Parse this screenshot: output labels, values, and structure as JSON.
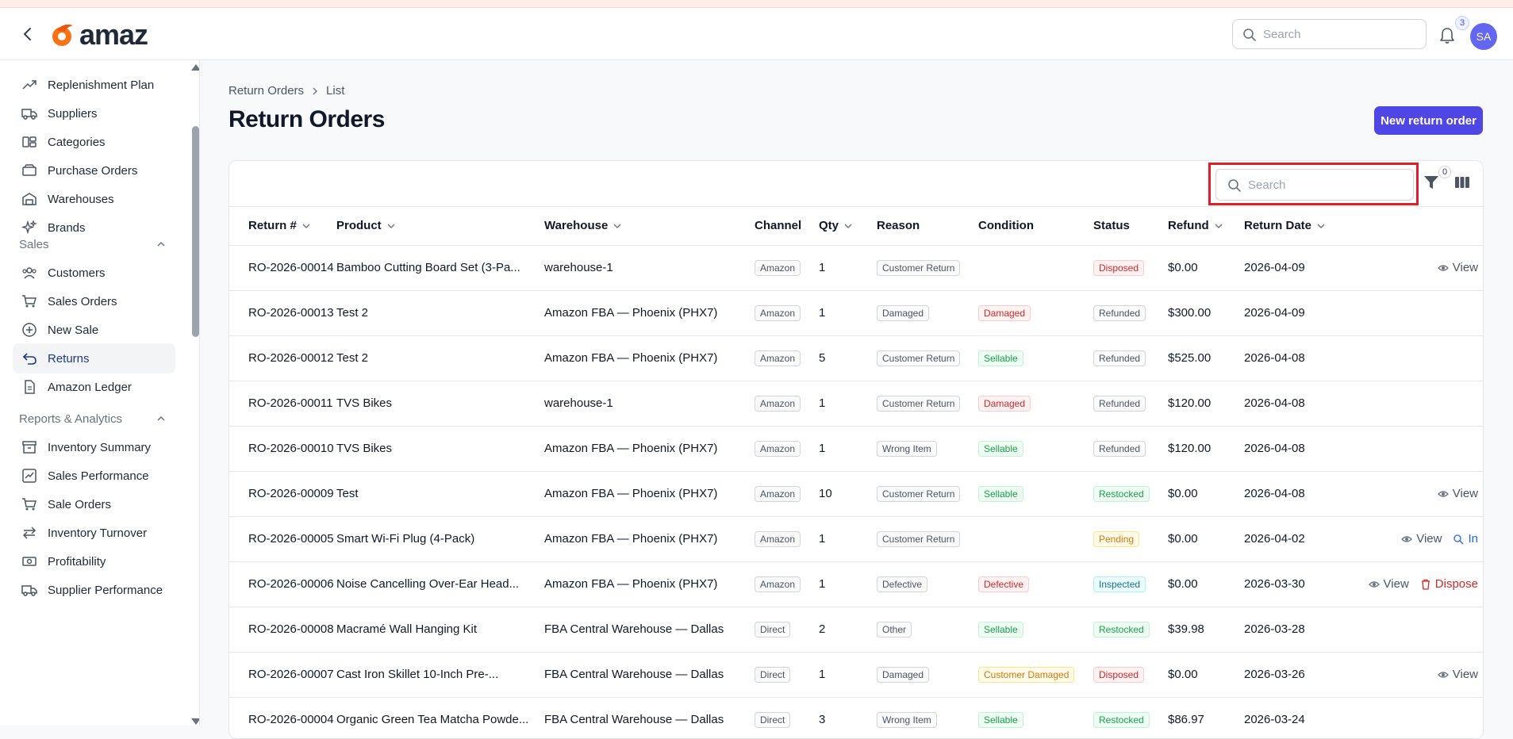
{
  "app": {
    "logo_text": "amaz",
    "user_initials": "SA",
    "notification_count": "3"
  },
  "header": {
    "search_placeholder": "Search"
  },
  "sidebar": {
    "items_top": [
      {
        "label": "Replenishment Plan",
        "icon": "trend-up-icon"
      },
      {
        "label": "Suppliers",
        "icon": "truck-icon"
      },
      {
        "label": "Categories",
        "icon": "categories-icon"
      },
      {
        "label": "Purchase Orders",
        "icon": "package-icon"
      },
      {
        "label": "Warehouses",
        "icon": "warehouse-icon"
      },
      {
        "label": "Brands",
        "icon": "sparkles-icon"
      }
    ],
    "section_sales": "Sales",
    "items_sales": [
      {
        "label": "Customers",
        "icon": "users-icon"
      },
      {
        "label": "Sales Orders",
        "icon": "cart-icon"
      },
      {
        "label": "New Sale",
        "icon": "plus-circle-icon"
      },
      {
        "label": "Returns",
        "icon": "return-icon"
      },
      {
        "label": "Amazon Ledger",
        "icon": "document-icon"
      }
    ],
    "section_reports": "Reports & Analytics",
    "items_reports": [
      {
        "label": "Inventory Summary",
        "icon": "archive-icon"
      },
      {
        "label": "Sales Performance",
        "icon": "chart-icon"
      },
      {
        "label": "Sale Orders",
        "icon": "cart-icon"
      },
      {
        "label": "Inventory Turnover",
        "icon": "arrows-icon"
      },
      {
        "label": "Profitability",
        "icon": "money-icon"
      },
      {
        "label": "Supplier Performance",
        "icon": "truck-icon"
      }
    ]
  },
  "breadcrumb": {
    "parent": "Return Orders",
    "current": "List"
  },
  "page": {
    "title": "Return Orders",
    "new_button": "New return order"
  },
  "toolbar": {
    "search_placeholder": "Search",
    "filter_count": "0"
  },
  "table": {
    "columns": [
      "Return #",
      "Product",
      "Warehouse",
      "Channel",
      "Qty",
      "Reason",
      "Condition",
      "Status",
      "Refund",
      "Return Date"
    ],
    "actions": {
      "view": "View",
      "dispose": "Dispose",
      "inspect": "In"
    },
    "rows": [
      {
        "ret": "RO-2026-00014",
        "product": "Bamboo Cutting Board Set (3-Pa...",
        "warehouse": "warehouse-1",
        "channel": "Amazon",
        "qty": "1",
        "reason": "Customer Return",
        "condition": "",
        "status": "Disposed",
        "refund": "$0.00",
        "date": "2026-04-09"
      },
      {
        "ret": "RO-2026-00013",
        "product": "Test 2",
        "warehouse": "Amazon FBA — Phoenix (PHX7)",
        "channel": "Amazon",
        "qty": "1",
        "reason": "Damaged",
        "condition": "Damaged",
        "status": "Refunded",
        "refund": "$300.00",
        "date": "2026-04-09"
      },
      {
        "ret": "RO-2026-00012",
        "product": "Test 2",
        "warehouse": "Amazon FBA — Phoenix (PHX7)",
        "channel": "Amazon",
        "qty": "5",
        "reason": "Customer Return",
        "condition": "Sellable",
        "status": "Refunded",
        "refund": "$525.00",
        "date": "2026-04-08"
      },
      {
        "ret": "RO-2026-00011",
        "product": "TVS Bikes",
        "warehouse": "warehouse-1",
        "channel": "Amazon",
        "qty": "1",
        "reason": "Customer Return",
        "condition": "Damaged",
        "status": "Refunded",
        "refund": "$120.00",
        "date": "2026-04-08"
      },
      {
        "ret": "RO-2026-00010",
        "product": "TVS Bikes",
        "warehouse": "Amazon FBA — Phoenix (PHX7)",
        "channel": "Amazon",
        "qty": "1",
        "reason": "Wrong Item",
        "condition": "Sellable",
        "status": "Refunded",
        "refund": "$120.00",
        "date": "2026-04-08"
      },
      {
        "ret": "RO-2026-00009",
        "product": "Test",
        "warehouse": "Amazon FBA — Phoenix (PHX7)",
        "channel": "Amazon",
        "qty": "10",
        "reason": "Customer Return",
        "condition": "Sellable",
        "status": "Restocked",
        "refund": "$0.00",
        "date": "2026-04-08"
      },
      {
        "ret": "RO-2026-00005",
        "product": "Smart Wi-Fi Plug (4-Pack)",
        "warehouse": "Amazon FBA — Phoenix (PHX7)",
        "channel": "Amazon",
        "qty": "1",
        "reason": "Customer Return",
        "condition": "",
        "status": "Pending",
        "refund": "$0.00",
        "date": "2026-04-02"
      },
      {
        "ret": "RO-2026-00006",
        "product": "Noise Cancelling Over-Ear Head...",
        "warehouse": "Amazon FBA — Phoenix (PHX7)",
        "channel": "Amazon",
        "qty": "1",
        "reason": "Defective",
        "condition": "Defective",
        "status": "Inspected",
        "refund": "$0.00",
        "date": "2026-03-30"
      },
      {
        "ret": "RO-2026-00008",
        "product": "Macramé Wall Hanging Kit",
        "warehouse": "FBA Central Warehouse — Dallas",
        "channel": "Direct",
        "qty": "2",
        "reason": "Other",
        "condition": "Sellable",
        "status": "Restocked",
        "refund": "$39.98",
        "date": "2026-03-28"
      },
      {
        "ret": "RO-2026-00007",
        "product": "Cast Iron Skillet 10-Inch Pre-...",
        "warehouse": "FBA Central Warehouse — Dallas",
        "channel": "Direct",
        "qty": "1",
        "reason": "Damaged",
        "condition": "Customer Damaged",
        "status": "Disposed",
        "refund": "$0.00",
        "date": "2026-03-26"
      },
      {
        "ret": "RO-2026-00004",
        "product": "Organic Green Tea Matcha Powde...",
        "warehouse": "FBA Central Warehouse — Dallas",
        "channel": "Direct",
        "qty": "3",
        "reason": "Wrong Item",
        "condition": "Sellable",
        "status": "Restocked",
        "refund": "$86.97",
        "date": "2026-03-24"
      }
    ]
  }
}
